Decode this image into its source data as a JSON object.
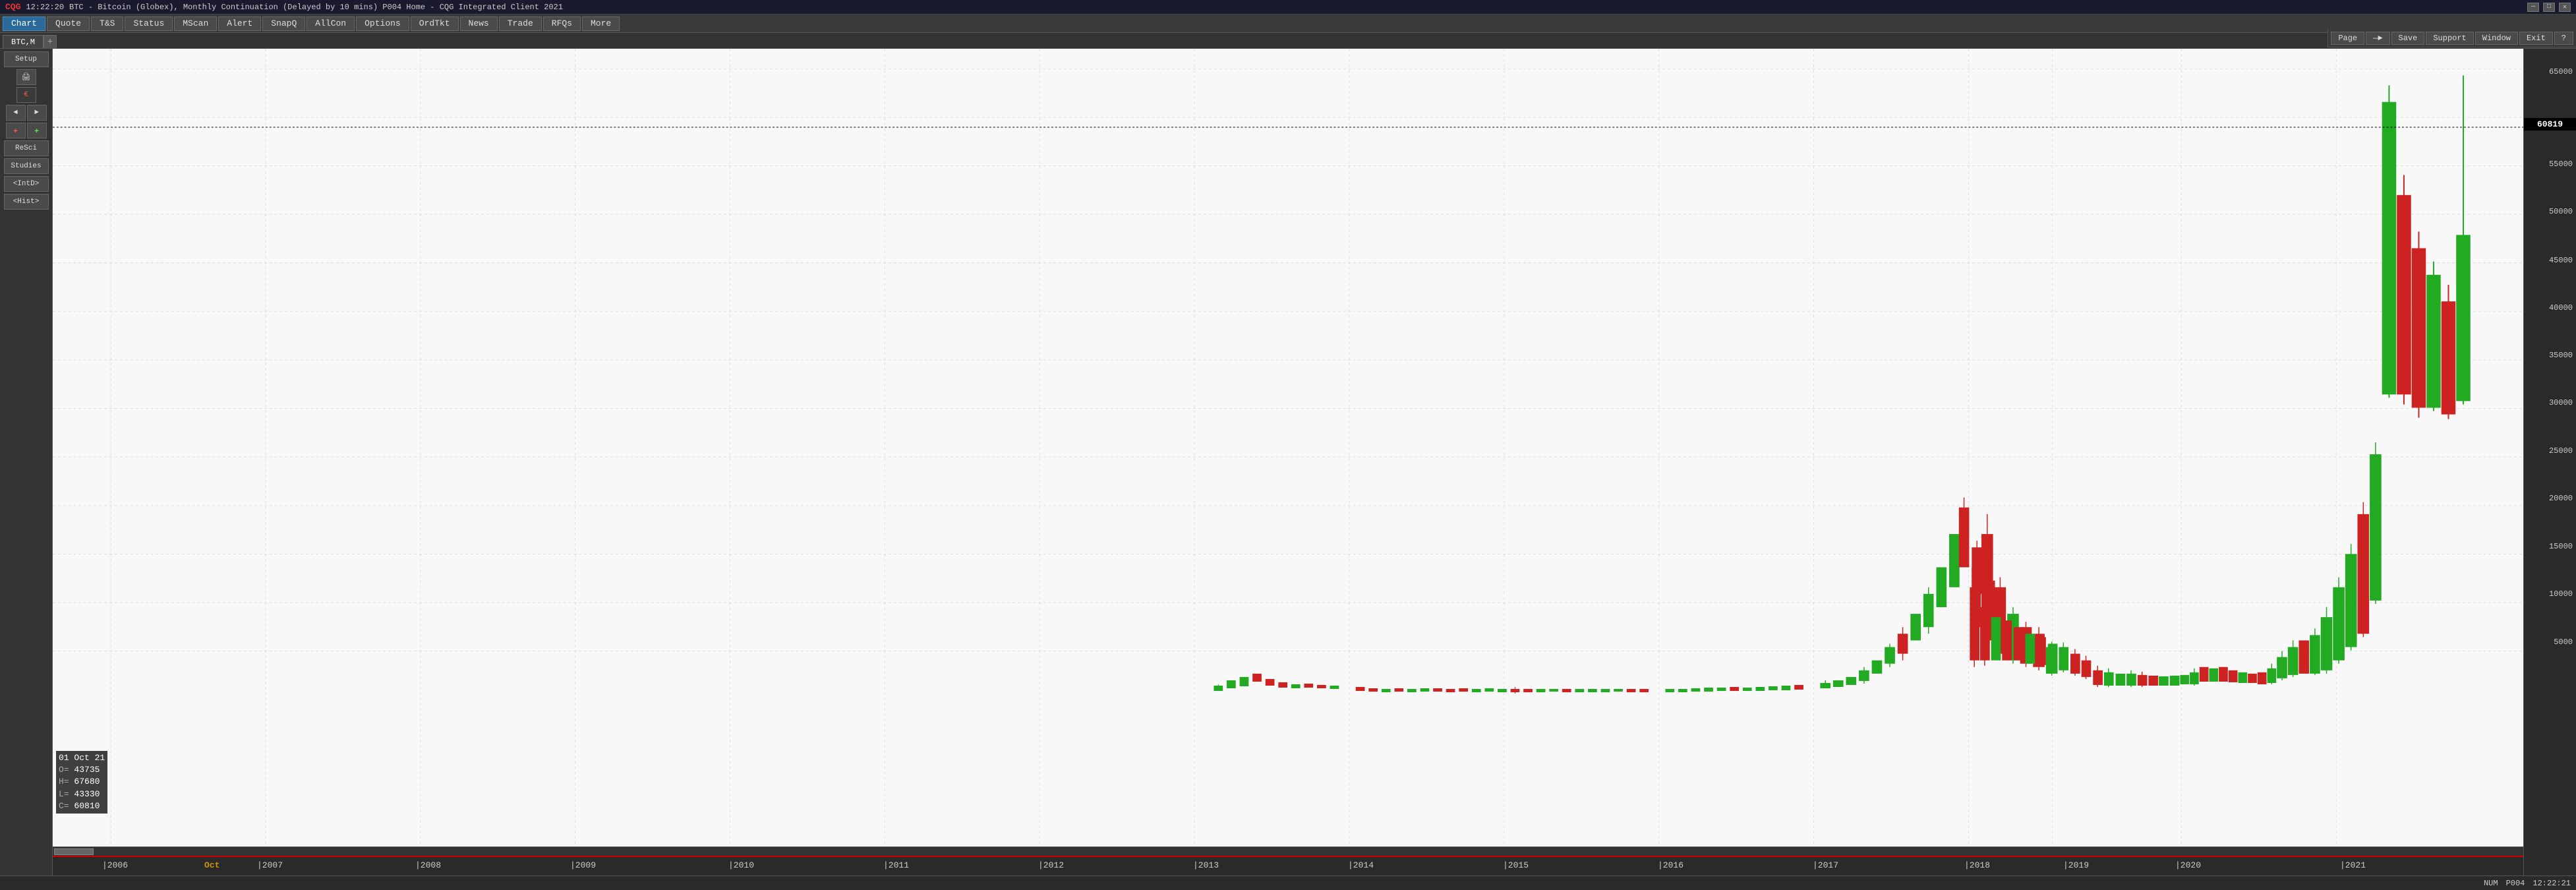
{
  "titlebar": {
    "logo": "CQG",
    "time": "12:22:20",
    "title": "BTC - Bitcoin (Globex), Monthly Continuation (Delayed by 10 mins)   P004 Home - CQG Integrated Client 2021",
    "minimize": "—",
    "maximize": "□",
    "close": "✕"
  },
  "menubar": {
    "buttons": [
      "Chart",
      "Quote",
      "T&S",
      "Status",
      "MScan",
      "Alert",
      "SnapQ",
      "AllCon",
      "Options",
      "OrdTkt",
      "News",
      "Trade",
      "RFQs",
      "More"
    ],
    "active": "Chart"
  },
  "righttoolbar": {
    "buttons": [
      "Page",
      "—►",
      "Save",
      "Support",
      "Window",
      "Exit",
      "?"
    ]
  },
  "tabs": {
    "items": [
      "BTC,M"
    ],
    "add": "+"
  },
  "sidebar": {
    "buttons": [
      "Setup",
      "ReSci",
      "Studies",
      "<IntD>",
      "<Hist>"
    ],
    "iconrows": [
      [
        "🖨",
        ""
      ],
      [
        "€",
        ""
      ],
      [
        "◄",
        "►"
      ],
      [
        "✚",
        "✚"
      ]
    ]
  },
  "chart": {
    "symbol": "BTC,M",
    "priceLabels": [
      "65000",
      "55000",
      "50000",
      "45000",
      "40000",
      "35000",
      "30000",
      "25000",
      "20000",
      "15000",
      "10000",
      "5000"
    ],
    "priceValues": [
      65000,
      55000,
      50000,
      45000,
      40000,
      35000,
      30000,
      25000,
      20000,
      15000,
      10000,
      5000
    ],
    "timeLabels": [
      "|2006",
      "|2007",
      "|2008",
      "|2009",
      "|2010",
      "|2011",
      "|2012",
      "|2013",
      "|2014",
      "|2015",
      "|2016",
      "|2017",
      "|2018",
      "|2019",
      "|2020",
      "|2021"
    ],
    "currentPrice": "60819",
    "ohlc": {
      "date": "01  Oct  21",
      "o_label": "O=",
      "o_value": "43735",
      "h_label": "H=",
      "h_value": "67680",
      "l_label": "L=",
      "l_value": "43330",
      "c_label": "C=",
      "c_value": "60810"
    }
  },
  "statusbar": {
    "left": "",
    "num": "NUM",
    "page": "P004",
    "time": "12:22:21"
  }
}
